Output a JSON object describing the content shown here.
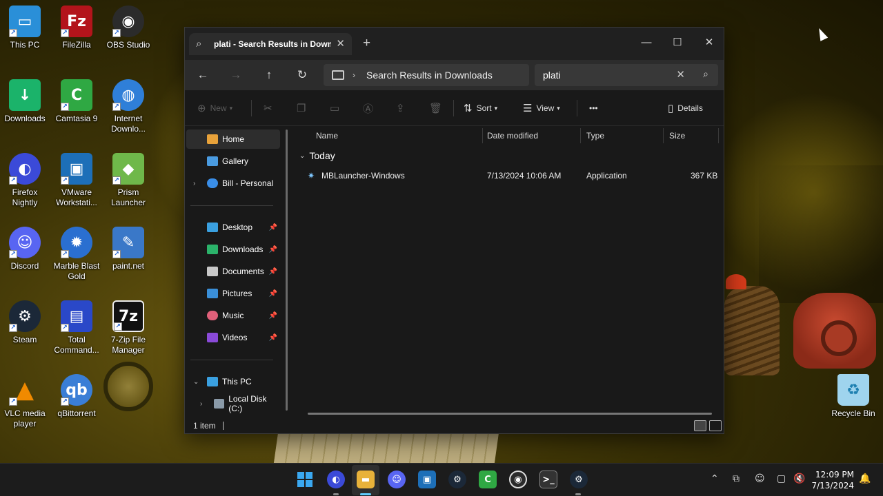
{
  "desktop": {
    "icons": [
      {
        "label": "This PC",
        "icon": "monitor-icon",
        "color": "#2a8fd8"
      },
      {
        "label": "FileZilla",
        "icon": "filezilla-icon",
        "color": "#b3141b"
      },
      {
        "label": "OBS Studio",
        "icon": "obs-icon",
        "color": "#2b2b2b"
      },
      {
        "label": "Downloads",
        "icon": "download-folder-icon",
        "color": "#1bb36a"
      },
      {
        "label": "Camtasia 9",
        "icon": "camtasia-icon",
        "color": "#2fa843"
      },
      {
        "label": "Internet Downlo...",
        "icon": "globe-icon",
        "color": "#2f7fd8"
      },
      {
        "label": "Firefox Nightly",
        "icon": "firefox-icon",
        "color": "#3b4ad8"
      },
      {
        "label": "VMware Workstati...",
        "icon": "vmware-icon",
        "color": "#1d6fb8"
      },
      {
        "label": "Prism Launcher",
        "icon": "prism-icon",
        "color": "#6fb84a"
      },
      {
        "label": "Discord",
        "icon": "discord-icon",
        "color": "#5865f2"
      },
      {
        "label": "Marble Blast Gold",
        "icon": "marble-icon",
        "color": "#2a6fd0"
      },
      {
        "label": "paint.net",
        "icon": "paintnet-icon",
        "color": "#3a78c8"
      },
      {
        "label": "Steam",
        "icon": "steam-icon",
        "color": "#1b2838"
      },
      {
        "label": "Total Command...",
        "icon": "floppy-icon",
        "color": "#2a48c8"
      },
      {
        "label": "7-Zip File Manager",
        "icon": "sevenzip-icon",
        "color": "#111111"
      },
      {
        "label": "VLC media player",
        "icon": "vlc-icon",
        "color": "#f08a00"
      },
      {
        "label": "qBittorrent",
        "icon": "qbittorrent-icon",
        "color": "#3a7ed6"
      },
      {
        "label": "Recycle Bin",
        "icon": "recycle-bin-icon",
        "color": "#9fd4ee"
      }
    ]
  },
  "explorer": {
    "tab_title": "plati - Search Results in Downl",
    "address_path": "Search Results in Downloads",
    "search_value": "plati",
    "toolbar": {
      "new_label": "New",
      "sort_label": "Sort",
      "view_label": "View",
      "more_label": "•••",
      "details_label": "Details"
    },
    "sidebar": {
      "home": "Home",
      "gallery": "Gallery",
      "onedrive": "Bill - Personal",
      "quick": [
        "Desktop",
        "Downloads",
        "Documents",
        "Pictures",
        "Music",
        "Videos"
      ],
      "this_pc": "This PC",
      "local_disk": "Local Disk (C:)"
    },
    "columns": [
      "Name",
      "Date modified",
      "Type",
      "Size"
    ],
    "group_label": "Today",
    "files": [
      {
        "name": "MBLauncher-Windows",
        "date": "7/13/2024 10:06 AM",
        "type": "Application",
        "size": "367 KB"
      }
    ],
    "status": "1 item"
  },
  "taskbar": {
    "time": "12:09 PM",
    "date": "7/13/2024"
  },
  "colors": {
    "accent": "#60cdff",
    "window_bg": "#191919",
    "taskbar_bg": "#1c1c1c"
  }
}
